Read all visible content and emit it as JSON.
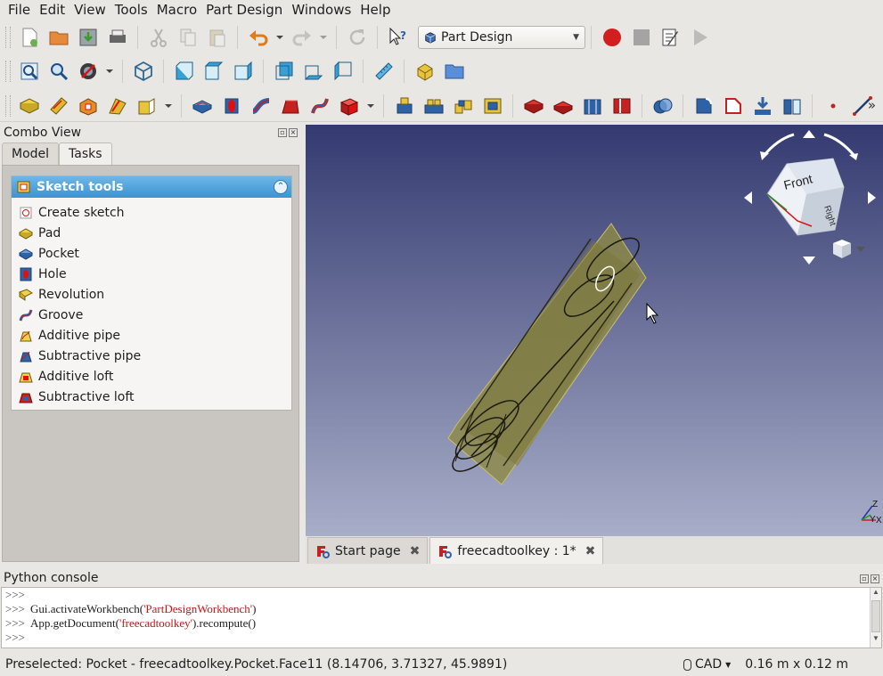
{
  "menu": [
    "File",
    "Edit",
    "View",
    "Tools",
    "Macro",
    "Part Design",
    "Windows",
    "Help"
  ],
  "workbench": {
    "selected": "Part Design"
  },
  "combo_view": {
    "title": "Combo View",
    "tabs": [
      "Model",
      "Tasks"
    ],
    "active_tab": "Tasks",
    "panel_title": "Sketch tools",
    "items": [
      {
        "label": "Create sketch",
        "icon": "sketch-icon"
      },
      {
        "label": "Pad",
        "icon": "pad-icon"
      },
      {
        "label": "Pocket",
        "icon": "pocket-icon"
      },
      {
        "label": "Hole",
        "icon": "hole-icon"
      },
      {
        "label": "Revolution",
        "icon": "revolution-icon"
      },
      {
        "label": "Groove",
        "icon": "groove-icon"
      },
      {
        "label": "Additive pipe",
        "icon": "additive-pipe-icon"
      },
      {
        "label": "Subtractive pipe",
        "icon": "subtractive-pipe-icon"
      },
      {
        "label": "Additive loft",
        "icon": "additive-loft-icon"
      },
      {
        "label": "Subtractive loft",
        "icon": "subtractive-loft-icon"
      }
    ]
  },
  "view3d": {
    "navcube_face_front": "Front",
    "navcube_face_right": "Right",
    "axis_labels": [
      "Z",
      "Y",
      "X"
    ],
    "colors": {
      "bg_top": "#343a70",
      "bg_bottom": "#a8aec8",
      "part": "#a39a4a"
    }
  },
  "document_tabs": [
    {
      "label": "Start page",
      "active": false
    },
    {
      "label": "freecadtoolkey : 1*",
      "active": true
    }
  ],
  "python_console": {
    "title": "Python console",
    "lines": [
      {
        "prompt": ">>>",
        "parts": []
      },
      {
        "prompt": ">>>",
        "parts": [
          "Gui.activateWorkbench(",
          "'PartDesignWorkbench'",
          ")"
        ]
      },
      {
        "prompt": ">>>",
        "parts": [
          "App.getDocument(",
          "'freecadtoolkey'",
          ").recompute()"
        ]
      },
      {
        "prompt": ">>>",
        "parts": []
      }
    ]
  },
  "status": {
    "text": "Preselected: Pocket - freecadtoolkey.Pocket.Face11 (8.14706, 3.71327, 45.9891)",
    "nav_style": "CAD",
    "dimensions": "0.16 m x 0.12 m"
  }
}
